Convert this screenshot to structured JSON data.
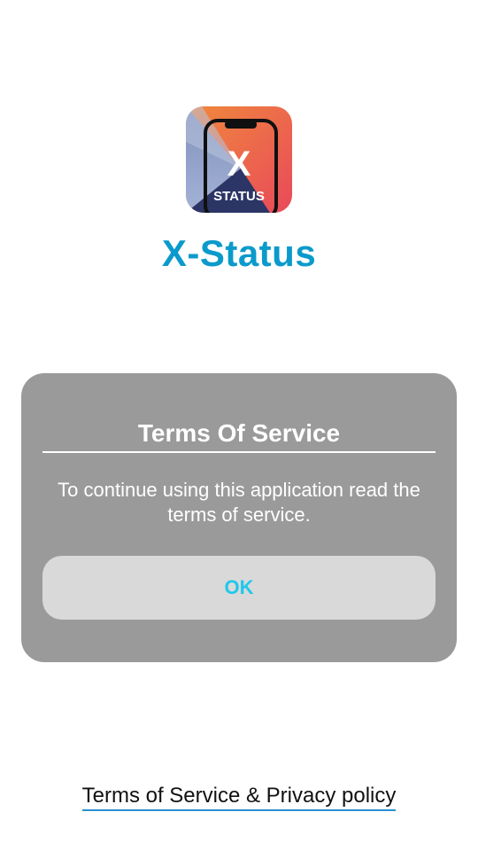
{
  "app": {
    "name": "X-Status",
    "icon": {
      "name": "x-status-app-icon",
      "letter": "X",
      "label": "STATUS"
    }
  },
  "dialog": {
    "title": "Terms Of Service",
    "message": "To continue using this application read the terms of service.",
    "ok_label": "OK"
  },
  "footer": {
    "link_label": "Terms of Service & Privacy policy"
  },
  "colors": {
    "accent_title": "#0a9acb",
    "ok_text": "#1ec8ec",
    "dialog_bg": "#9a9a9a",
    "button_bg": "#d9d9d9",
    "link_underline": "#2a8fd0"
  }
}
